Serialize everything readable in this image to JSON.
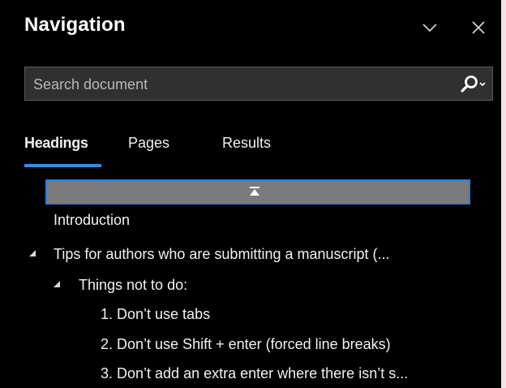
{
  "pane": {
    "title": "Navigation",
    "menu_icon": "chevron-down-icon",
    "close_icon": "close-icon"
  },
  "search": {
    "placeholder": "Search document",
    "icon": "search-icon",
    "dropdown_icon": "chevron-down-icon"
  },
  "tabs": [
    {
      "label": "Headings",
      "active": true
    },
    {
      "label": "Pages",
      "active": false
    },
    {
      "label": "Results",
      "active": false
    }
  ],
  "headings": [
    {
      "label": "Introduction",
      "level": 1,
      "expanded": null
    },
    {
      "label": "Tips for authors who are submitting a manuscript  (...",
      "level": 1,
      "expanded": true
    },
    {
      "label": "Things not to do:",
      "level": 2,
      "expanded": true
    },
    {
      "label": "1. Don’t use tabs",
      "level": 3,
      "expanded": null
    },
    {
      "label": "2. Don’t use Shift + enter (forced line breaks)",
      "level": 3,
      "expanded": null
    },
    {
      "label": "3. Don’t add an extra enter where there isn’t s...",
      "level": 3,
      "expanded": null
    }
  ],
  "colors": {
    "background": "#000000",
    "accent": "#2f8fe6",
    "search_bg": "#303030",
    "scroll_button_bg": "#7b7b7b"
  }
}
